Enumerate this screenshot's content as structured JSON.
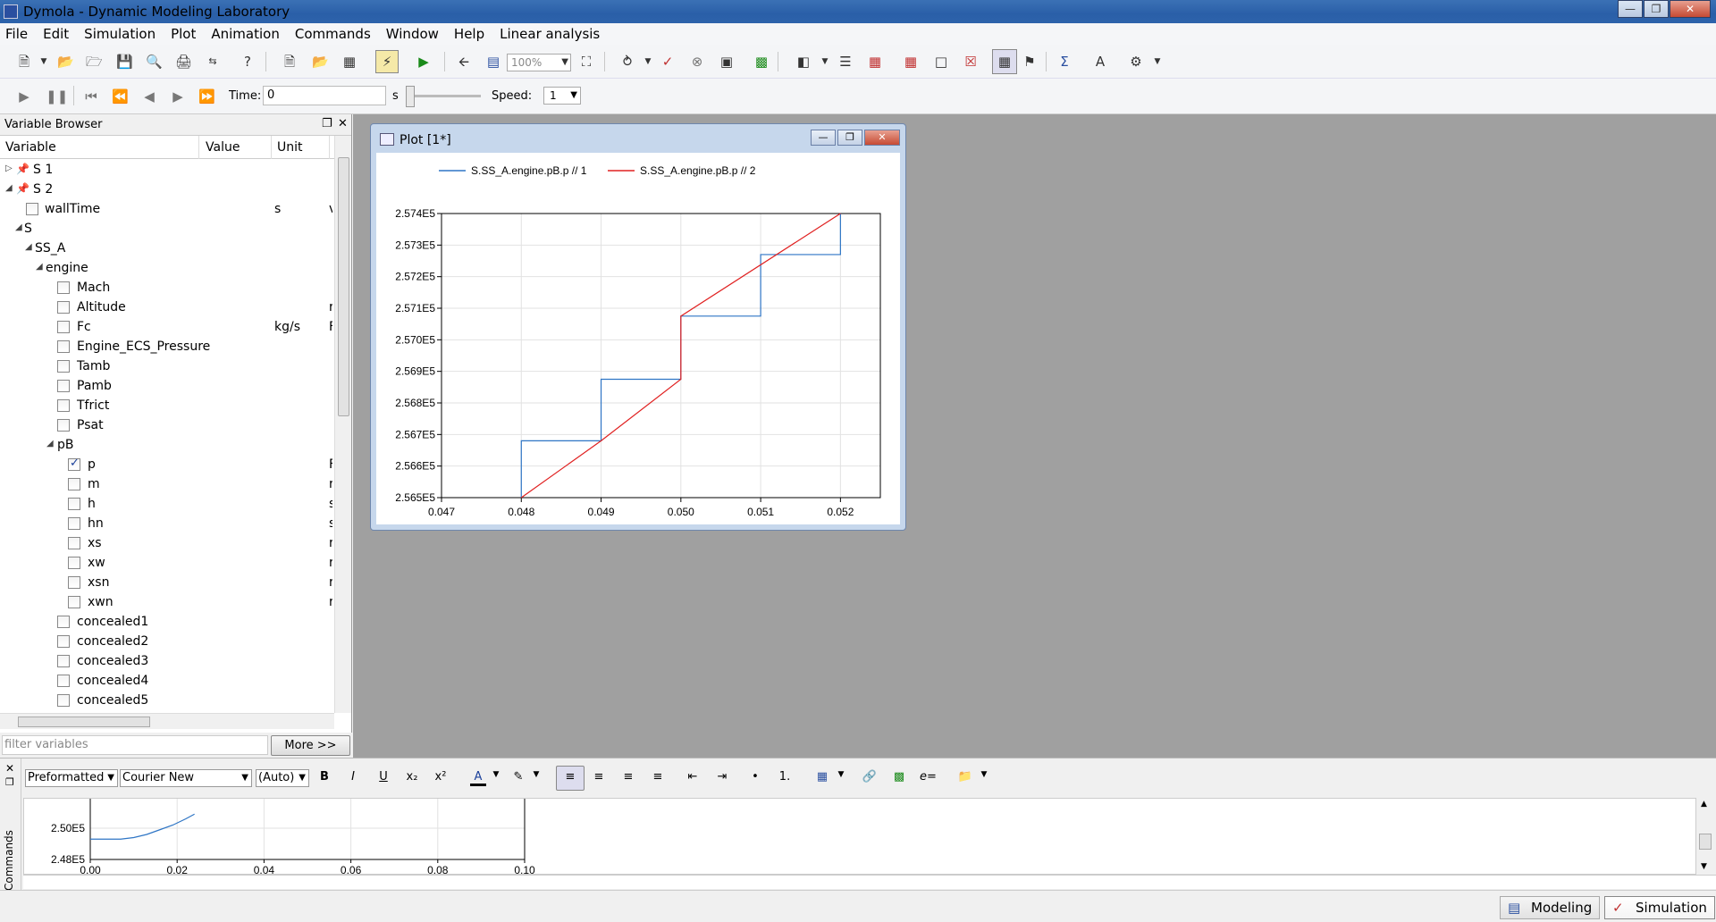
{
  "window": {
    "title": "Dymola - Dynamic Modeling Laboratory"
  },
  "menu": [
    "File",
    "Edit",
    "Simulation",
    "Plot",
    "Animation",
    "Commands",
    "Window",
    "Help",
    "Linear analysis"
  ],
  "toolbar": {
    "zoom_value": "100%"
  },
  "animation_bar": {
    "time_label": "Time:",
    "time_value": "0",
    "time_unit": "s",
    "speed_label": "Speed:",
    "speed_value": "1"
  },
  "variable_browser": {
    "title": "Variable Browser",
    "columns": {
      "variable": "Variable",
      "value": "Value",
      "unit": "Unit"
    },
    "rows": [
      {
        "label": "S 1",
        "unit": "",
        "cut": ""
      },
      {
        "label": "S 2",
        "unit": "",
        "cut": ""
      },
      {
        "label": "wallTime",
        "unit": "s",
        "cut": "v"
      },
      {
        "label": "S",
        "unit": "",
        "cut": ""
      },
      {
        "label": "SS_A",
        "unit": "",
        "cut": ""
      },
      {
        "label": "engine",
        "unit": "",
        "cut": ""
      },
      {
        "label": "Mach",
        "unit": "",
        "cut": ""
      },
      {
        "label": "Altitude",
        "unit": "",
        "cut": "r"
      },
      {
        "label": "Fc",
        "unit": "kg/s",
        "cut": "F"
      },
      {
        "label": "Engine_ECS_Pressure",
        "unit": "",
        "cut": ""
      },
      {
        "label": "Tamb",
        "unit": "",
        "cut": ""
      },
      {
        "label": "Pamb",
        "unit": "",
        "cut": ""
      },
      {
        "label": "Tfrict",
        "unit": "",
        "cut": ""
      },
      {
        "label": "Psat",
        "unit": "",
        "cut": ""
      },
      {
        "label": "pB",
        "unit": "",
        "cut": ""
      },
      {
        "label": "p",
        "unit": "",
        "cut": "F"
      },
      {
        "label": "m",
        "unit": "",
        "cut": "r"
      },
      {
        "label": "h",
        "unit": "",
        "cut": "s"
      },
      {
        "label": "hn",
        "unit": "",
        "cut": "s"
      },
      {
        "label": "xs",
        "unit": "",
        "cut": "r"
      },
      {
        "label": "xw",
        "unit": "",
        "cut": "r"
      },
      {
        "label": "xsn",
        "unit": "",
        "cut": "r"
      },
      {
        "label": "xwn",
        "unit": "",
        "cut": "r"
      },
      {
        "label": "concealed1",
        "unit": "",
        "cut": ""
      },
      {
        "label": "concealed2",
        "unit": "",
        "cut": ""
      },
      {
        "label": "concealed3",
        "unit": "",
        "cut": ""
      },
      {
        "label": "concealed4",
        "unit": "",
        "cut": ""
      },
      {
        "label": "concealed5",
        "unit": "",
        "cut": ""
      }
    ],
    "filter_placeholder": "filter variables",
    "more_button": "More >>"
  },
  "plot_window": {
    "title": "Plot [1*]"
  },
  "chart_data": [
    {
      "type": "line",
      "title": "",
      "xlabel": "",
      "ylabel": "",
      "xlim": [
        0.047,
        0.0525
      ],
      "ylim": [
        256500,
        257400
      ],
      "xticks": [
        "0.047",
        "0.048",
        "0.049",
        "0.050",
        "0.051",
        "0.052"
      ],
      "yticks": [
        "2.565E5",
        "2.566E5",
        "2.567E5",
        "2.568E5",
        "2.569E5",
        "2.570E5",
        "2.571E5",
        "2.572E5",
        "2.573E5",
        "2.574E5"
      ],
      "grid": true,
      "legend": "top",
      "series": [
        {
          "name": "S.SS_A.engine.pB.p // 1",
          "color": "#2e75c5",
          "x": [
            0.048,
            0.048,
            0.049,
            0.049,
            0.05,
            0.05,
            0.051,
            0.051,
            0.052,
            0.052
          ],
          "y": [
            256500,
            256680,
            256680,
            256875,
            256875,
            257075,
            257075,
            257270,
            257270,
            257400
          ]
        },
        {
          "name": "S.SS_A.engine.pB.p // 2",
          "color": "#e02020",
          "x": [
            0.048,
            0.049,
            0.05,
            0.05,
            0.052
          ],
          "y": [
            256500,
            256680,
            256875,
            257075,
            257400
          ]
        }
      ]
    },
    {
      "type": "line",
      "title": "",
      "xlim": [
        0.0,
        0.1
      ],
      "xticks": [
        "0.00",
        "0.02",
        "0.04",
        "0.06",
        "0.08",
        "0.10"
      ],
      "yticks": [
        "2.48E5",
        "2.50E5"
      ],
      "grid": true,
      "series": [
        {
          "color": "#2e75c5",
          "x": [
            0.0,
            0.007,
            0.01,
            0.013,
            0.016,
            0.019,
            0.022,
            0.024
          ],
          "y": [
            249300,
            249300,
            249400,
            249600,
            249900,
            250200,
            250600,
            250900
          ]
        }
      ]
    }
  ],
  "format_toolbar": {
    "style": "Preformatted",
    "font": "Courier New",
    "size": "(Auto)"
  },
  "commands_panel": {
    "label": "Commands"
  },
  "status_bar": {
    "modeling": "Modeling",
    "simulation": "Simulation"
  }
}
